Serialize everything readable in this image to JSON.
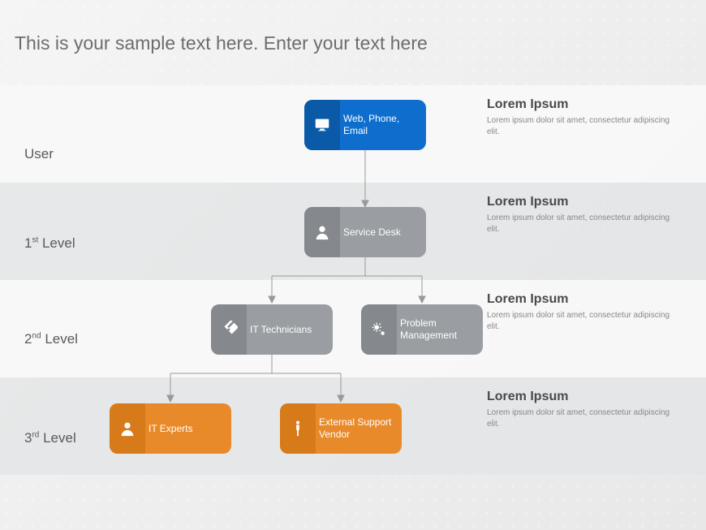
{
  "title": "This is your sample text here. Enter your text here",
  "rows": [
    {
      "label": "User",
      "heading": "Lorem Ipsum",
      "body": "Lorem ipsum dolor sit amet, consectetur adipiscing elit."
    },
    {
      "label": "1st Level",
      "heading": "Lorem Ipsum",
      "body": "Lorem ipsum dolor sit amet, consectetur adipiscing elit."
    },
    {
      "label": "2nd Level",
      "heading": "Lorem Ipsum",
      "body": "Lorem ipsum dolor sit amet, consectetur adipiscing elit."
    },
    {
      "label": "3rd Level",
      "heading": "Lorem Ipsum",
      "body": "Lorem ipsum dolor sit amet, consectetur adipiscing elit."
    }
  ],
  "nodes": {
    "user": {
      "label": "Web, Phone, Email",
      "icon": "monitor"
    },
    "l1": {
      "label": "Service Desk",
      "icon": "person"
    },
    "l2a": {
      "label": "IT Technicians",
      "icon": "tools"
    },
    "l2b": {
      "label": "Problem Management",
      "icon": "gears"
    },
    "l3a": {
      "label": "IT Experts",
      "icon": "person"
    },
    "l3b": {
      "label": "External Support Vendor",
      "icon": "standing"
    }
  }
}
